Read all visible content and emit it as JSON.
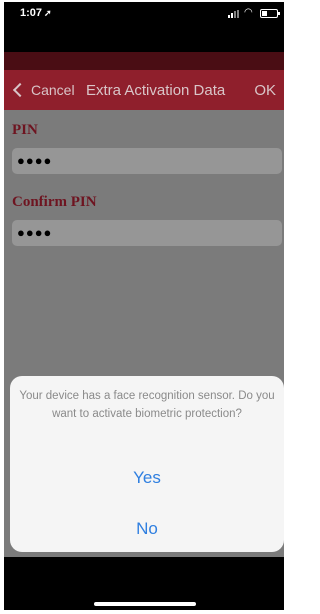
{
  "status_bar": {
    "time": "1:07",
    "location_icon": "location-arrow-icon",
    "signal_icon": "cellular-signal-icon",
    "wifi_icon": "wifi-icon",
    "battery_icon": "battery-icon"
  },
  "nav": {
    "cancel_label": "Cancel",
    "title": "Extra Activation Data",
    "ok_label": "OK"
  },
  "form": {
    "pin_label": "PIN",
    "pin_value": "●●●●",
    "confirm_pin_label": "Confirm PIN",
    "confirm_pin_value": "●●●●"
  },
  "dialog": {
    "message": "Your device has a face recognition sensor. Do you want to activate biometric protection?",
    "yes_label": "Yes",
    "no_label": "No"
  },
  "colors": {
    "nav_bar": "#8f1f2c",
    "label_color": "#6e1420",
    "dialog_button": "#2f7fe0"
  }
}
